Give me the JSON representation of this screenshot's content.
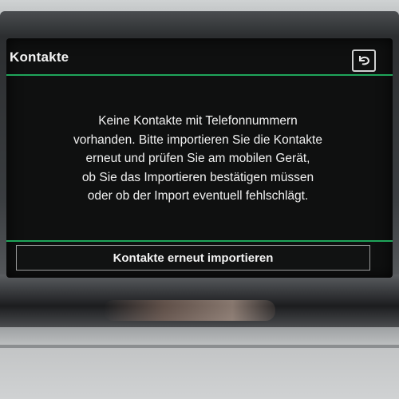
{
  "header": {
    "title": "Kontakte",
    "back_icon": "back-arrow-icon"
  },
  "message": {
    "lines": [
      "Keine Kontakte mit Telefonnummern",
      "vorhanden. Bitte importieren Sie die Kontakte",
      "erneut und prüfen Sie am mobilen Gerät,",
      "ob Sie das Importieren bestätigen müssen",
      "oder ob der Import eventuell fehlschlägt."
    ]
  },
  "actions": {
    "reimport_label": "Kontakte erneut importieren"
  },
  "colors": {
    "accent_line": "#1fa55a",
    "screen_background": "#0f1010",
    "text": "#f2f2f2"
  }
}
